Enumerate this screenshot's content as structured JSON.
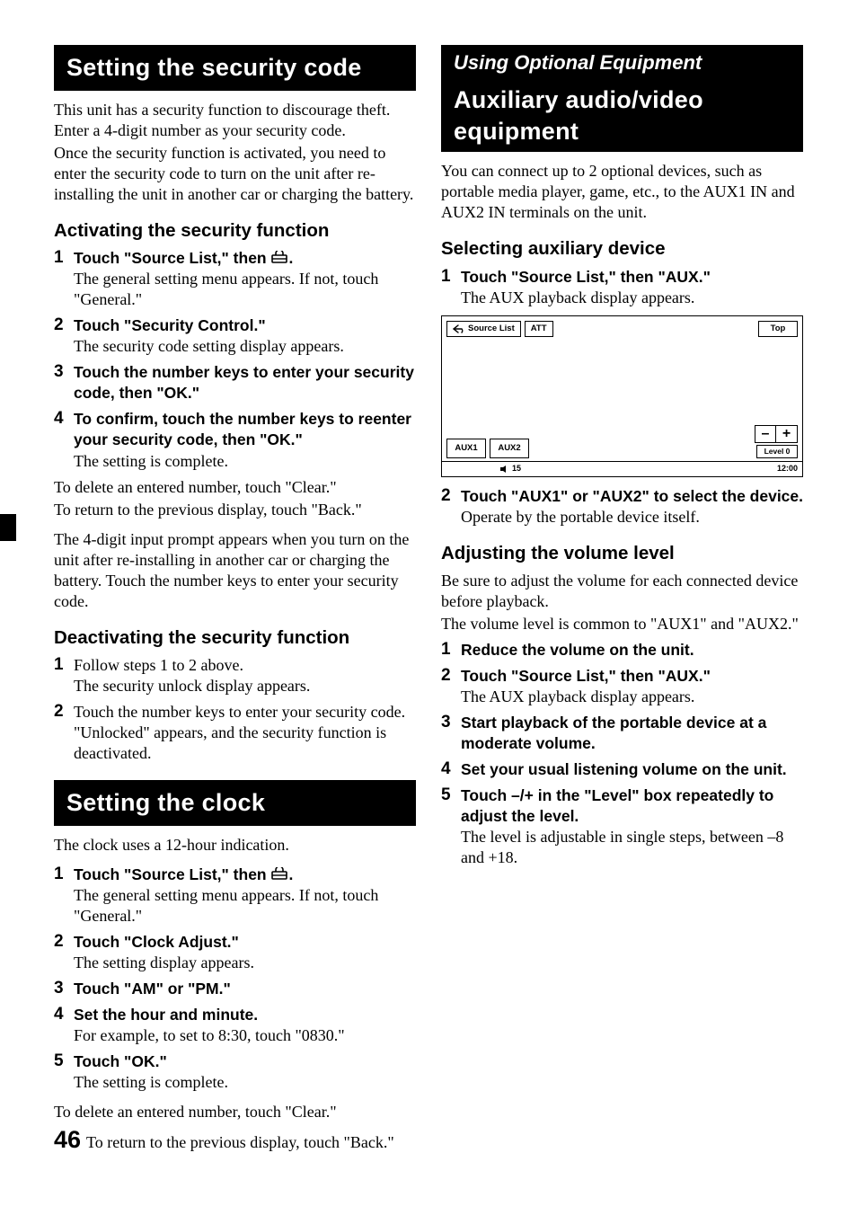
{
  "left": {
    "sec1": {
      "title": "Setting the security code",
      "intro1": "This unit has a security function to discourage theft. Enter a 4-digit number as your security code.",
      "intro2": "Once the security function is activated, you need to enter the security code to turn on the unit after re-installing the unit in another car or charging the battery.",
      "activate": {
        "heading": "Activating the security function",
        "s1_t": "Touch \"Source List,\" then ",
        "s1_d": "The general setting menu appears. If not, touch \"General.\"",
        "s2_t": "Touch \"Security Control.\"",
        "s2_d": "The security code setting display appears.",
        "s3_t": "Touch the number keys to enter your security code, then \"OK.\"",
        "s4_t": "To confirm, touch the number keys to reenter your security code, then \"OK.\"",
        "s4_d": "The setting is complete.",
        "post1": "To delete an entered number, touch \"Clear.\"",
        "post2": "To return to the previous display, touch \"Back.\"",
        "post3": "The 4-digit input prompt appears when you turn on the unit after re-installing in another car or charging the battery. Touch the number keys to enter your security code."
      },
      "deactivate": {
        "heading": "Deactivating the security function",
        "s1_d": "Follow steps 1 to 2 above.",
        "s1_d2": "The security unlock display appears.",
        "s2_d": "Touch the number keys to enter your security code.",
        "s2_d2": "\"Unlocked\" appears, and the security function is deactivated."
      }
    },
    "sec2": {
      "title": "Setting the clock",
      "intro": "The clock uses a 12-hour indication.",
      "s1_t": "Touch \"Source List,\" then ",
      "s1_d": "The general setting menu appears. If not, touch \"General.\"",
      "s2_t": "Touch \"Clock Adjust.\"",
      "s2_d": "The setting display appears.",
      "s3_t": "Touch \"AM\" or \"PM.\"",
      "s4_t": "Set the hour and minute.",
      "s4_d": "For example, to set to 8:30, touch \"0830.\"",
      "s5_t": "Touch \"OK.\"",
      "s5_d": "The setting is complete.",
      "post1": "To delete an entered number, touch \"Clear.\"",
      "post2": "To return to the previous display, touch \"Back.\""
    }
  },
  "right": {
    "sup": "Using Optional Equipment",
    "title": "Auxiliary audio/video equipment",
    "intro": "You can connect up to 2 optional devices, such as portable media player, game, etc., to the AUX1 IN and AUX2 IN terminals on the unit.",
    "select": {
      "heading": "Selecting auxiliary device",
      "s1_t": "Touch \"Source List,\" then \"AUX.\"",
      "s1_d": "The AUX playback display appears.",
      "s2_t": "Touch \"AUX1\" or \"AUX2\" to select the device.",
      "s2_d": "Operate by the portable device itself."
    },
    "figure": {
      "source_list": "Source List",
      "att": "ATT",
      "top": "Top",
      "aux1": "AUX1",
      "aux2": "AUX2",
      "minus": "–",
      "plus": "+",
      "level": "Level 0",
      "vol": "15",
      "time": "12:00"
    },
    "adjust": {
      "heading": "Adjusting the volume level",
      "intro1": "Be sure to adjust the volume for each connected device before playback.",
      "intro2": "The volume level is common to \"AUX1\" and \"AUX2.\"",
      "s1_t": "Reduce the volume on the unit.",
      "s2_t": "Touch \"Source List,\" then \"AUX.\"",
      "s2_d": "The AUX playback display appears.",
      "s3_t": "Start playback of the portable device at a moderate volume.",
      "s4_t": "Set your usual listening volume on the unit.",
      "s5_t": "Touch –/+ in the \"Level\" box repeatedly to adjust the level.",
      "s5_d": "The level is adjustable in single steps, between –8 and +18."
    }
  },
  "page_number": "46"
}
